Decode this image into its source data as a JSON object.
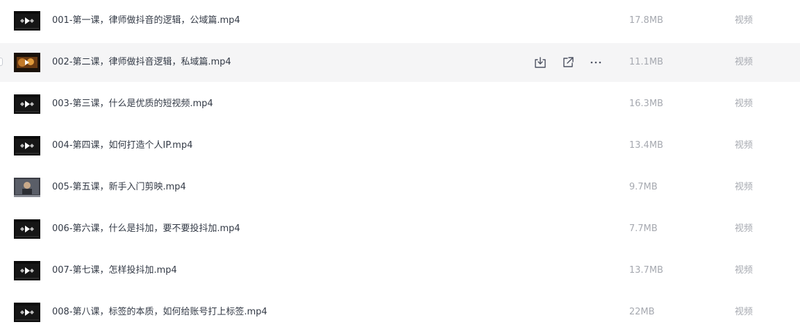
{
  "files": [
    {
      "name": "001-第一课，律师做抖音的逻辑，公域篇.mp4",
      "size": "17.8MB",
      "type": "视频",
      "thumbnail": "video-thumbnail-dark"
    },
    {
      "name": "002-第二课，律师做抖音逻辑，私域篇.mp4",
      "size": "11.1MB",
      "type": "视频",
      "thumbnail": "video-thumbnail-orange"
    },
    {
      "name": "003-第三课，什么是优质的短视频.mp4",
      "size": "16.3MB",
      "type": "视频",
      "thumbnail": "video-thumbnail-dark"
    },
    {
      "name": "004-第四课，如何打造个人IP.mp4",
      "size": "13.4MB",
      "type": "视频",
      "thumbnail": "video-thumbnail-dark"
    },
    {
      "name": "005-第五课，新手入门剪映.mp4",
      "size": "9.7MB",
      "type": "视频",
      "thumbnail": "video-thumbnail-photo"
    },
    {
      "name": "006-第六课，什么是抖加，要不要投抖加.mp4",
      "size": "7.7MB",
      "type": "视频",
      "thumbnail": "video-thumbnail-dark"
    },
    {
      "name": "007-第七课，怎样投抖加.mp4",
      "size": "13.7MB",
      "type": "视频",
      "thumbnail": "video-thumbnail-dark"
    },
    {
      "name": "008-第八课，标签的本质，如何给账号打上标签.mp4",
      "size": "22MB",
      "type": "视频",
      "thumbnail": "video-thumbnail-dark"
    }
  ],
  "hovered_row_index": 1,
  "row_actions": [
    {
      "icon": "download-icon"
    },
    {
      "icon": "share-icon"
    },
    {
      "icon": "more-icon"
    }
  ],
  "colors": {
    "hover_background": "#f5f5f6",
    "name_text": "#333a46",
    "meta_text": "#a6a9b0",
    "action_icon": "#4b5060"
  }
}
